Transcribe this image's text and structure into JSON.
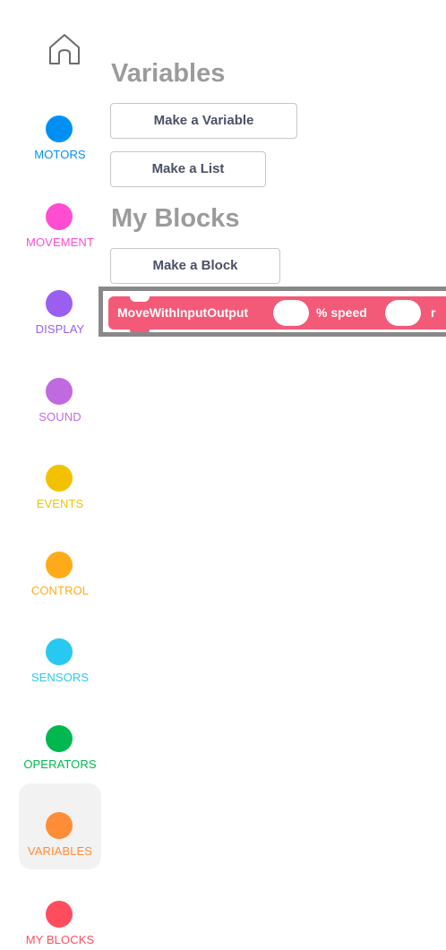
{
  "sidebar": {
    "categories": [
      {
        "label": "MOTORS",
        "color": "#0090f5",
        "selected": false
      },
      {
        "label": "MOVEMENT",
        "color": "#ff4dd2",
        "selected": false
      },
      {
        "label": "DISPLAY",
        "color": "#9a5ef0",
        "selected": false
      },
      {
        "label": "SOUND",
        "color": "#c06ae0",
        "selected": false
      },
      {
        "label": "EVENTS",
        "color": "#f2c200",
        "selected": false
      },
      {
        "label": "CONTROL",
        "color": "#ffab19",
        "selected": false
      },
      {
        "label": "SENSORS",
        "color": "#28c9f0",
        "selected": false
      },
      {
        "label": "OPERATORS",
        "color": "#00b84f",
        "selected": false
      },
      {
        "label": "VARIABLES",
        "color": "#ff8c36",
        "selected": true
      },
      {
        "label": "MY BLOCKS",
        "color": "#ff4d5e",
        "selected": false
      }
    ]
  },
  "palette": {
    "variables_title": "Variables",
    "make_variable_label": "Make a Variable",
    "make_list_label": "Make a List",
    "my_blocks_title": "My Blocks",
    "make_block_label": "Make a Block",
    "custom_block": {
      "name": "MoveWithInputOutput",
      "speed_label": "% speed",
      "trailing_label": "r",
      "color": "#f25a78"
    }
  }
}
